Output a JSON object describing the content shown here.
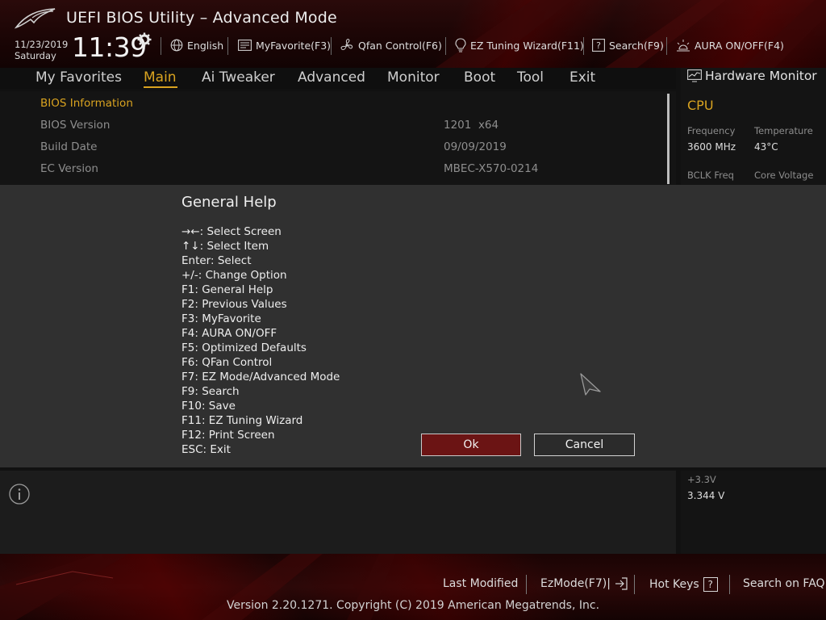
{
  "app": {
    "title": "UEFI BIOS Utility – Advanced Mode",
    "date": "11/23/2019",
    "day": "Saturday",
    "time": "11:39"
  },
  "toolbar": {
    "language": "English",
    "my_favorite": "MyFavorite(F3)",
    "qfan": "Qfan Control(F6)",
    "ez_tuning": "EZ Tuning Wizard(F11)",
    "search": "Search(F9)",
    "aura": "AURA ON/OFF(F4)"
  },
  "nav": {
    "tabs": [
      "My Favorites",
      "Main",
      "Ai Tweaker",
      "Advanced",
      "Monitor",
      "Boot",
      "Tool",
      "Exit"
    ],
    "active": "Main"
  },
  "bios_info": {
    "section_label": "BIOS Information",
    "rows": [
      {
        "label": "BIOS Version",
        "value": "1201  x64"
      },
      {
        "label": "Build Date",
        "value": "09/09/2019"
      },
      {
        "label": "EC Version",
        "value": "MBEC-X570-0214"
      }
    ]
  },
  "hw_monitor": {
    "title": "Hardware Monitor",
    "cpu_label": "CPU",
    "frequency_label": "Frequency",
    "frequency_value": "3600 MHz",
    "temperature_label": "Temperature",
    "temperature_value": "43°C",
    "bclk_label": "BCLK Freq",
    "core_voltage_label": "Core Voltage",
    "v33_label": "+3.3V",
    "v33_value": "3.344 V"
  },
  "dialog": {
    "title": "General Help",
    "items": [
      "→←: Select Screen",
      "↑↓: Select Item",
      "Enter: Select",
      "+/-: Change Option",
      "F1: General Help",
      "F2: Previous Values",
      "F3: MyFavorite",
      "F4: AURA ON/OFF",
      "F5: Optimized Defaults",
      "F6: QFan Control",
      "F7: EZ Mode/Advanced Mode",
      "F9: Search",
      "F10: Save",
      "F11: EZ Tuning Wizard",
      "F12: Print Screen",
      "ESC: Exit"
    ],
    "ok_label": "Ok",
    "cancel_label": "Cancel"
  },
  "footer": {
    "last_modified": "Last Modified",
    "ez_mode": "EzMode(F7)|",
    "hot_keys": "Hot Keys",
    "hot_keys_icon_text": "?",
    "search_faq": "Search on FAQ",
    "copyright": "Version 2.20.1271. Copyright (C) 2019 American Megatrends, Inc."
  },
  "colors": {
    "accent": "#d9a320",
    "ok_button": "#6b1414",
    "dialog_bg": "#303030"
  }
}
